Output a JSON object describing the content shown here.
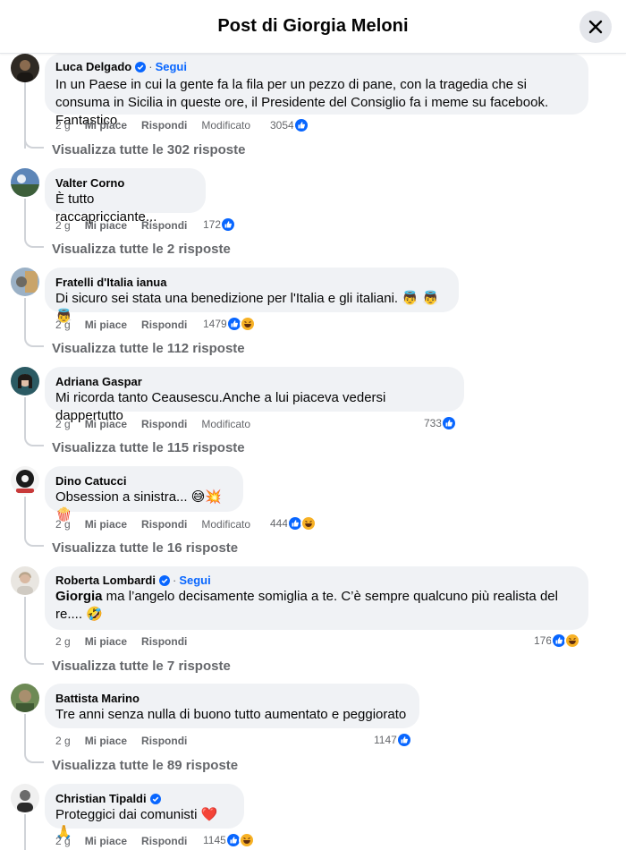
{
  "header": {
    "title": "Post di Giorgia Meloni"
  },
  "comments": [
    {
      "author": "Luca Delgado",
      "verified": true,
      "follow": "Segui",
      "text": "In un Paese in cui la gente fa la fila per un pezzo di pane, con la tragedia che si consuma in Sicilia in queste ore, il Presidente del Consiglio fa i meme su facebook. Fantastico.",
      "time": "2 g",
      "like": "Mi piace",
      "reply": "Rispondi",
      "edited": "Modificato",
      "reaction_count": "3054",
      "reactions": [
        "like"
      ],
      "replies": "Visualizza tutte le 302 risposte"
    },
    {
      "author": "Valter Corno",
      "text": "È tutto raccapricciante...",
      "time": "2 g",
      "like": "Mi piace",
      "reply": "Rispondi",
      "reaction_count": "172",
      "reactions": [
        "like"
      ],
      "replies": "Visualizza tutte le 2 risposte"
    },
    {
      "author": "Fratelli d'Italia ianua",
      "text": "Di sicuro sei stata una benedizione per l'Italia e gli italiani. 👼 👼 👼",
      "time": "2 g",
      "like": "Mi piace",
      "reply": "Rispondi",
      "reaction_count": "1479",
      "reactions": [
        "like",
        "haha"
      ],
      "replies": "Visualizza tutte le 112 risposte"
    },
    {
      "author": "Adriana Gaspar",
      "text": "Mi ricorda tanto Ceausescu.Anche a lui piaceva vedersi dappertutto",
      "time": "2 g",
      "like": "Mi piace",
      "reply": "Rispondi",
      "edited": "Modificato",
      "reaction_count": "733",
      "reactions": [
        "like"
      ],
      "replies": "Visualizza tutte le 115 risposte"
    },
    {
      "author": "Dino Catucci",
      "text": "Obsession a sinistra... 😅💥🍿",
      "time": "2 g",
      "like": "Mi piace",
      "reply": "Rispondi",
      "edited": "Modificato",
      "reaction_count": "444",
      "reactions": [
        "like",
        "haha"
      ],
      "replies": "Visualizza tutte le 16 risposte"
    },
    {
      "author": "Roberta Lombardi",
      "verified": true,
      "follow": "Segui",
      "tag": "Giorgia",
      "text": " ma l’angelo decisamente somiglia a te. C’è sempre qualcuno più realista del re.... 🤣",
      "time": "2 g",
      "like": "Mi piace",
      "reply": "Rispondi",
      "reaction_count": "176",
      "reactions": [
        "like",
        "haha"
      ],
      "replies": "Visualizza tutte le 7 risposte"
    },
    {
      "author": "Battista Marino",
      "text": "Tre anni senza nulla di buono tutto aumentato e peggiorato",
      "time": "2 g",
      "like": "Mi piace",
      "reply": "Rispondi",
      "reaction_count": "1147",
      "reactions": [
        "like"
      ],
      "replies": "Visualizza tutte le 89 risposte"
    },
    {
      "author": "Christian Tipaldi",
      "verified": true,
      "text": "Proteggici dai comunisti ❤️🙏",
      "time": "2 g",
      "like": "Mi piace",
      "reply": "Rispondi",
      "reaction_count": "1145",
      "reactions": [
        "like",
        "haha"
      ]
    }
  ],
  "colors": {
    "accent": "#0866ff",
    "bubble": "#f0f2f5",
    "muted": "#65676b",
    "text": "#050505"
  }
}
